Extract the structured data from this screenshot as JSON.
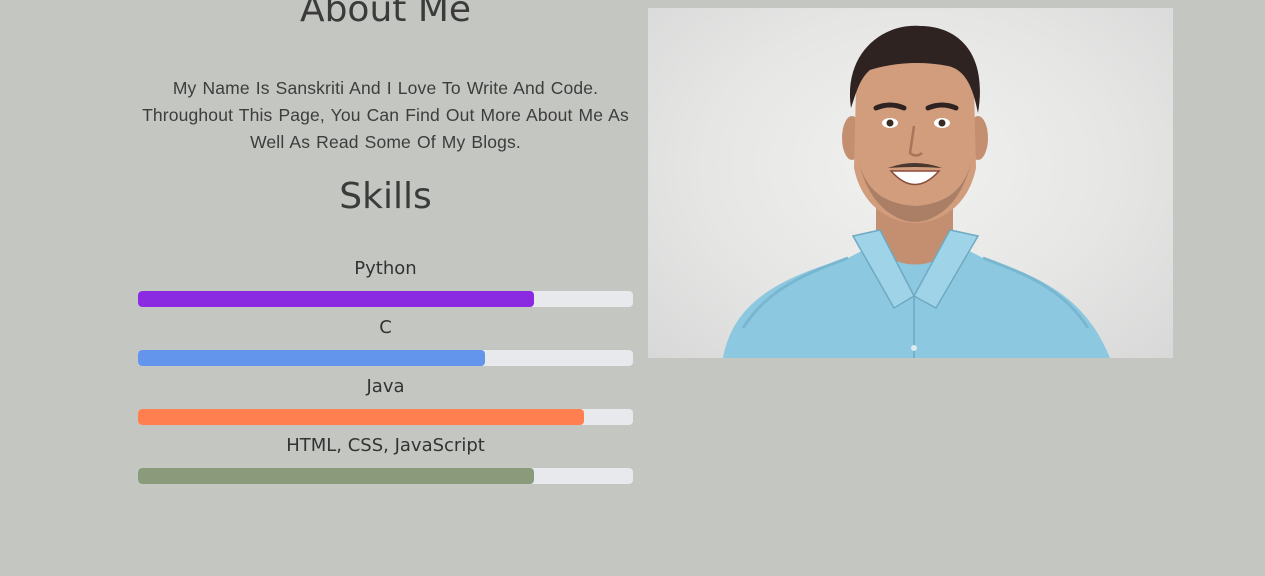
{
  "about": {
    "title": "About Me",
    "intro": "My Name Is Sanskriti And I Love To Write And Code. Throughout This Page, You Can Find Out More About Me As Well As Read Some Of My Blogs."
  },
  "skills": {
    "title": "Skills",
    "items": [
      {
        "name": "Python",
        "level_percent": 80,
        "color": "#8a2be2"
      },
      {
        "name": "C",
        "level_percent": 70,
        "color": "#6495ed"
      },
      {
        "name": "Java",
        "level_percent": 90,
        "color": "#ff7f50"
      },
      {
        "name": "HTML, CSS, JavaScript",
        "level_percent": 80,
        "color": "#8a9a7b"
      }
    ],
    "track_color": "#e7e9ec"
  },
  "colors": {
    "background": "#c4c6c2",
    "heading": "#3b3b3b",
    "text": "#3d3d3d"
  },
  "photo": {
    "icon": "profile-photo",
    "shirt_color": "#8cc8e0"
  }
}
